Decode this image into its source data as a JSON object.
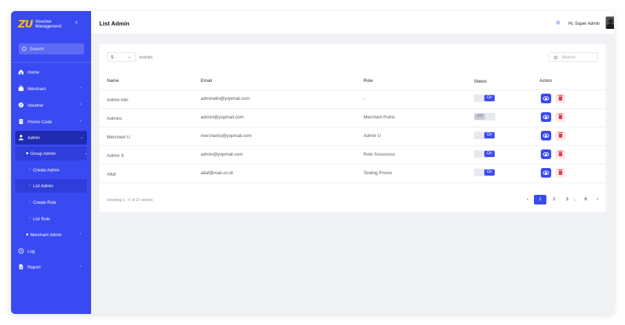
{
  "brand": {
    "logo": "ZU",
    "name": "Voucher Management"
  },
  "sidebar": {
    "search_placeholder": "Search",
    "items": [
      {
        "label": "Home"
      },
      {
        "label": "Merchant"
      },
      {
        "label": "Voucher"
      },
      {
        "label": "Promo Code"
      },
      {
        "label": "Admin"
      },
      {
        "label": "Group Admin"
      },
      {
        "label": "Create Admin"
      },
      {
        "label": "List Admin"
      },
      {
        "label": "Create Role"
      },
      {
        "label": "List Role"
      },
      {
        "label": "Merchant Admin"
      },
      {
        "label": "Log"
      },
      {
        "label": "Report"
      }
    ]
  },
  "header": {
    "title": "List Admin",
    "greeting": "Hi, Super Admin"
  },
  "table": {
    "page_length": "5",
    "entries_label": "entries",
    "search_placeholder": "Search",
    "columns": [
      "Name",
      "Email",
      "Role",
      "Status",
      "Action"
    ],
    "rows": [
      {
        "name": "Admin Alin",
        "email": "adminalin@yopmail.com",
        "role": "-",
        "status": "On"
      },
      {
        "name": "Admins",
        "email": "admini@yopmail.com",
        "role": "Merchant Putris",
        "status": "Off"
      },
      {
        "name": "Merchant U",
        "email": "merchantu@yopmail.com",
        "role": "Admin U",
        "status": "On"
      },
      {
        "name": "Admin S",
        "email": "admin@yopmail.com",
        "role": "Role Sssssssss",
        "status": "On"
      },
      {
        "name": "Altaf",
        "email": "altaf@mail.co.id",
        "role": "Testing Promo",
        "status": "On"
      }
    ],
    "showing_text": "Showing 1 - 5 of 27 entries"
  },
  "pagination": {
    "prev": "‹",
    "pages": [
      "1",
      "2",
      "3",
      "...",
      "6"
    ],
    "current": "1",
    "next": "›"
  },
  "colors": {
    "primary": "#3a4af2",
    "logo": "#ffb627",
    "danger": "#e23a4a"
  }
}
